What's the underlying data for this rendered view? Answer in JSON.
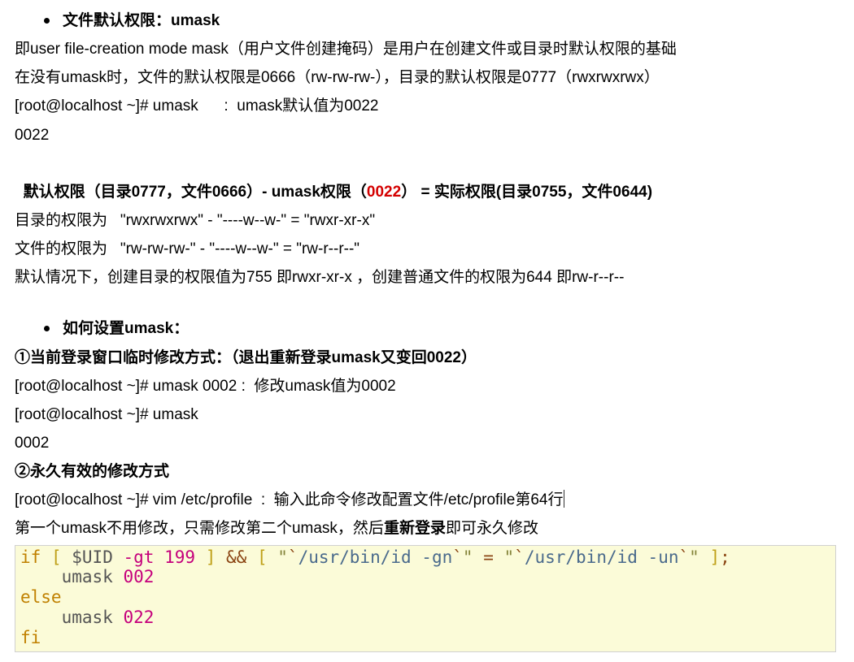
{
  "bullet1": "文件默认权限：umask",
  "l1": "即user file-creation mode mask（用户文件创建掩码）是用户在创建文件或目录时默认权限的基础",
  "l2": "在没有umask时，文件的默认权限是0666（rw-rw-rw-），目录的默认权限是0777（rwxrwxrwx）",
  "l3": "[root@localhost ~]# umask      :  umask默认值为0022",
  "l4": "0022",
  "formula_a": "默认权限（目录0777，文件0666）- umask权限（",
  "formula_red": "0022",
  "formula_b": "） = 实际权限(目录0755，文件0644)",
  "l6": "目录的权限为   \"rwxrwxrwx\" - \"----w--w-\" = \"rwxr-xr-x\"",
  "l7": "文件的权限为   \"rw-rw-rw-\" - \"----w--w-\" = \"rw-r--r--\"",
  "l8": "默认情况下，创建目录的权限值为755 即rwxr-xr-x ，创建普通文件的权限为644 即rw-r--r--",
  "bullet2": "如何设置umask：",
  "l10": "①当前登录窗口临时修改方式：（退出重新登录umask又变回0022）",
  "l11": "[root@localhost ~]# umask 0002 :  修改umask值为0002",
  "l12": "[root@localhost ~]# umask",
  "l13": "0002",
  "l14": "②永久有效的修改方式",
  "l15": "[root@localhost ~]# vim /etc/profile  :  输入此命令修改配置文件/etc/profile第64行",
  "l16a": "第一个umask不用修改，只需修改第二个umask，然后",
  "l16b": "重新登录",
  "l16c": "即可永久修改",
  "code": {
    "if": "if",
    "lb1": "[",
    "rb1": "]",
    "uid": "$UID",
    "gt": "-gt",
    "n199": "199",
    "and": "&&",
    "lb2": "[",
    "str_open1": "\"",
    "bt_open1": "`",
    "path_gn": "/usr/bin/id -gn",
    "bt_close1": "`",
    "str_close1": "\"",
    "eqs": "=",
    "str_open2": "\"",
    "bt_open2": "`",
    "path_un": "/usr/bin/id -un",
    "bt_close2": "`",
    "str_close2": "\"",
    "rb2": "]",
    "semi": ";",
    "umask1": "umask",
    "v002": "002",
    "else": "else",
    "umask2": "umask",
    "v022": "022",
    "fi": "fi"
  }
}
